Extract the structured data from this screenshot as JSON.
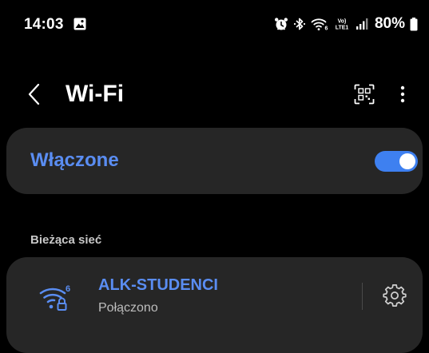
{
  "status_bar": {
    "time": "14:03",
    "battery": "80%",
    "icons": [
      "gallery-icon",
      "alarm-icon",
      "bluetooth-icon",
      "wifi-status-icon",
      "volte-icon",
      "signal-icon",
      "battery-icon"
    ],
    "volte_top": "Vo)",
    "volte_bottom": "LTE1"
  },
  "header": {
    "title": "Wi-Fi",
    "back_icon": "chevron-left-icon",
    "qr_icon": "qr-code-icon",
    "more_icon": "more-vert-icon"
  },
  "wifi_toggle": {
    "label": "Włączone",
    "state": "on",
    "accent": "#5a8df2",
    "switch_color": "#3e80f0"
  },
  "current_network": {
    "section_label": "Bieżąca sieć",
    "name": "ALK-STUDENCI",
    "status": "Połączono",
    "wifi_badge": "6",
    "icons": [
      "wifi-6-secured-icon",
      "gear-icon"
    ]
  }
}
